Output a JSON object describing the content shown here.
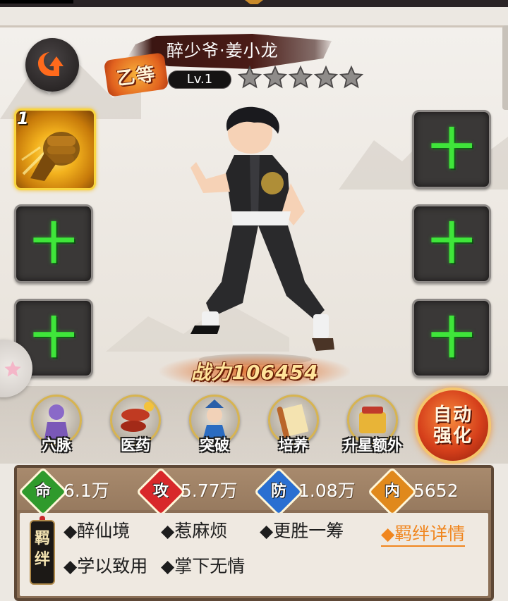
{
  "hero": {
    "grade": "乙等",
    "name": "醉少爷·姜小龙",
    "level": "Lv.1",
    "stars": 5,
    "power_text": "战力106454"
  },
  "equipment_slots": {
    "active_skill_level": "1",
    "empty_symbol": "十"
  },
  "functions": [
    {
      "label": "穴脉",
      "icon": "meridian-icon"
    },
    {
      "label": "医药",
      "icon": "medicine-icon"
    },
    {
      "label": "突破",
      "icon": "breakthrough-icon"
    },
    {
      "label": "培养",
      "icon": "scroll-icon"
    },
    {
      "label": "升星额外",
      "icon": "star-upgrade-icon"
    }
  ],
  "auto_enhance_label": "自动强化",
  "stats": [
    {
      "key": "命",
      "value": "6.1万",
      "color": "#2f9a2c"
    },
    {
      "key": "攻",
      "value": "5.77万",
      "color": "#d8282a"
    },
    {
      "key": "防",
      "value": "1.08万",
      "color": "#2a6fd1"
    },
    {
      "key": "内",
      "value": "5652",
      "color": "#e0891c"
    }
  ],
  "bonds": {
    "tag": "羁绊",
    "items": [
      "◆醉仙境",
      "◆惹麻烦",
      "◆更胜一筹",
      "◆学以致用",
      "◆掌下无情"
    ],
    "detail_link": "◆羁绊详情"
  },
  "colors": {
    "accent_orange": "#f0861f",
    "plus_green": "#3fe63a",
    "panel_brown": "#8b6f56"
  }
}
